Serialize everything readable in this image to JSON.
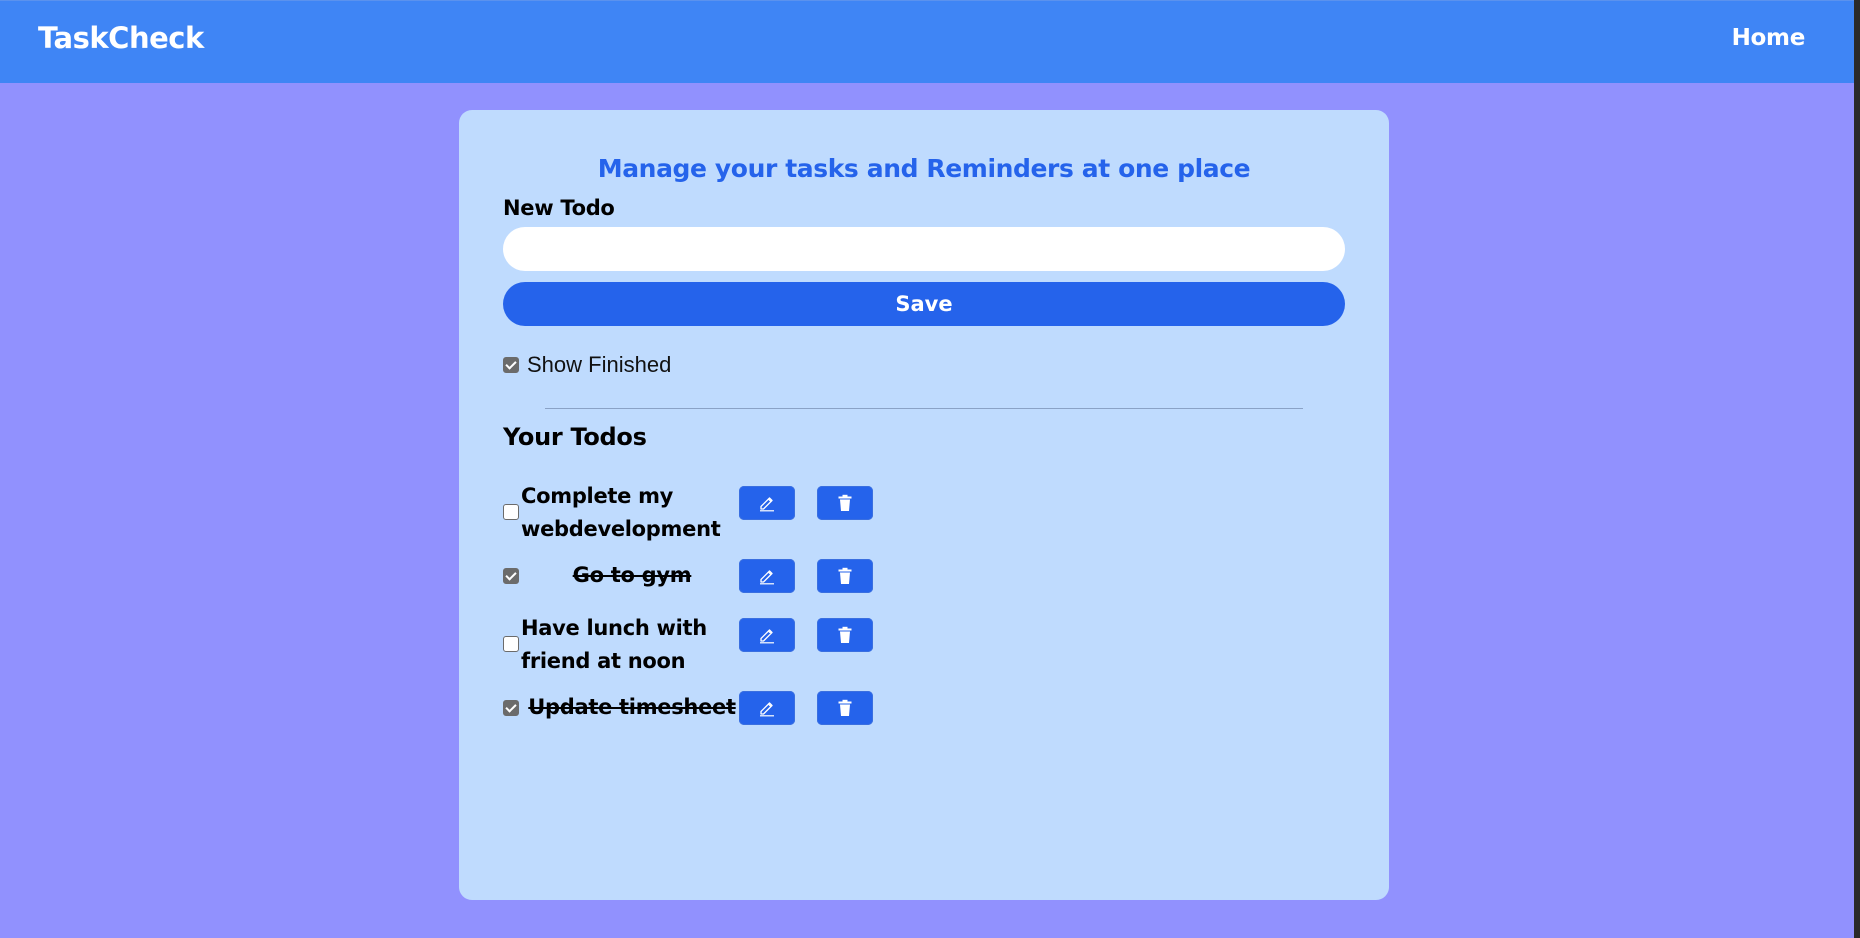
{
  "navbar": {
    "brand": "TaskCheck",
    "home_label": "Home",
    "bg_color": "#3f85f5"
  },
  "page_bg_color": "#9191fe",
  "card": {
    "heading": "Manage your tasks and Reminders at one place",
    "new_todo_label": "New Todo",
    "input_value": "",
    "input_placeholder": "",
    "save_label": "Save",
    "show_finished_label": "Show Finished",
    "show_finished_checked": true,
    "todos_title": "Your Todos",
    "bg_color": "#bfdbfe",
    "accent_color": "#2563eb"
  },
  "todos": [
    {
      "text": "Complete my webdevelopment",
      "completed": false
    },
    {
      "text": "Go to gym",
      "completed": true
    },
    {
      "text": "Have lunch with friend at noon",
      "completed": false
    },
    {
      "text": "Update timesheet",
      "completed": true
    }
  ],
  "icons": {
    "edit": "pencil-icon",
    "delete": "trash-icon"
  }
}
